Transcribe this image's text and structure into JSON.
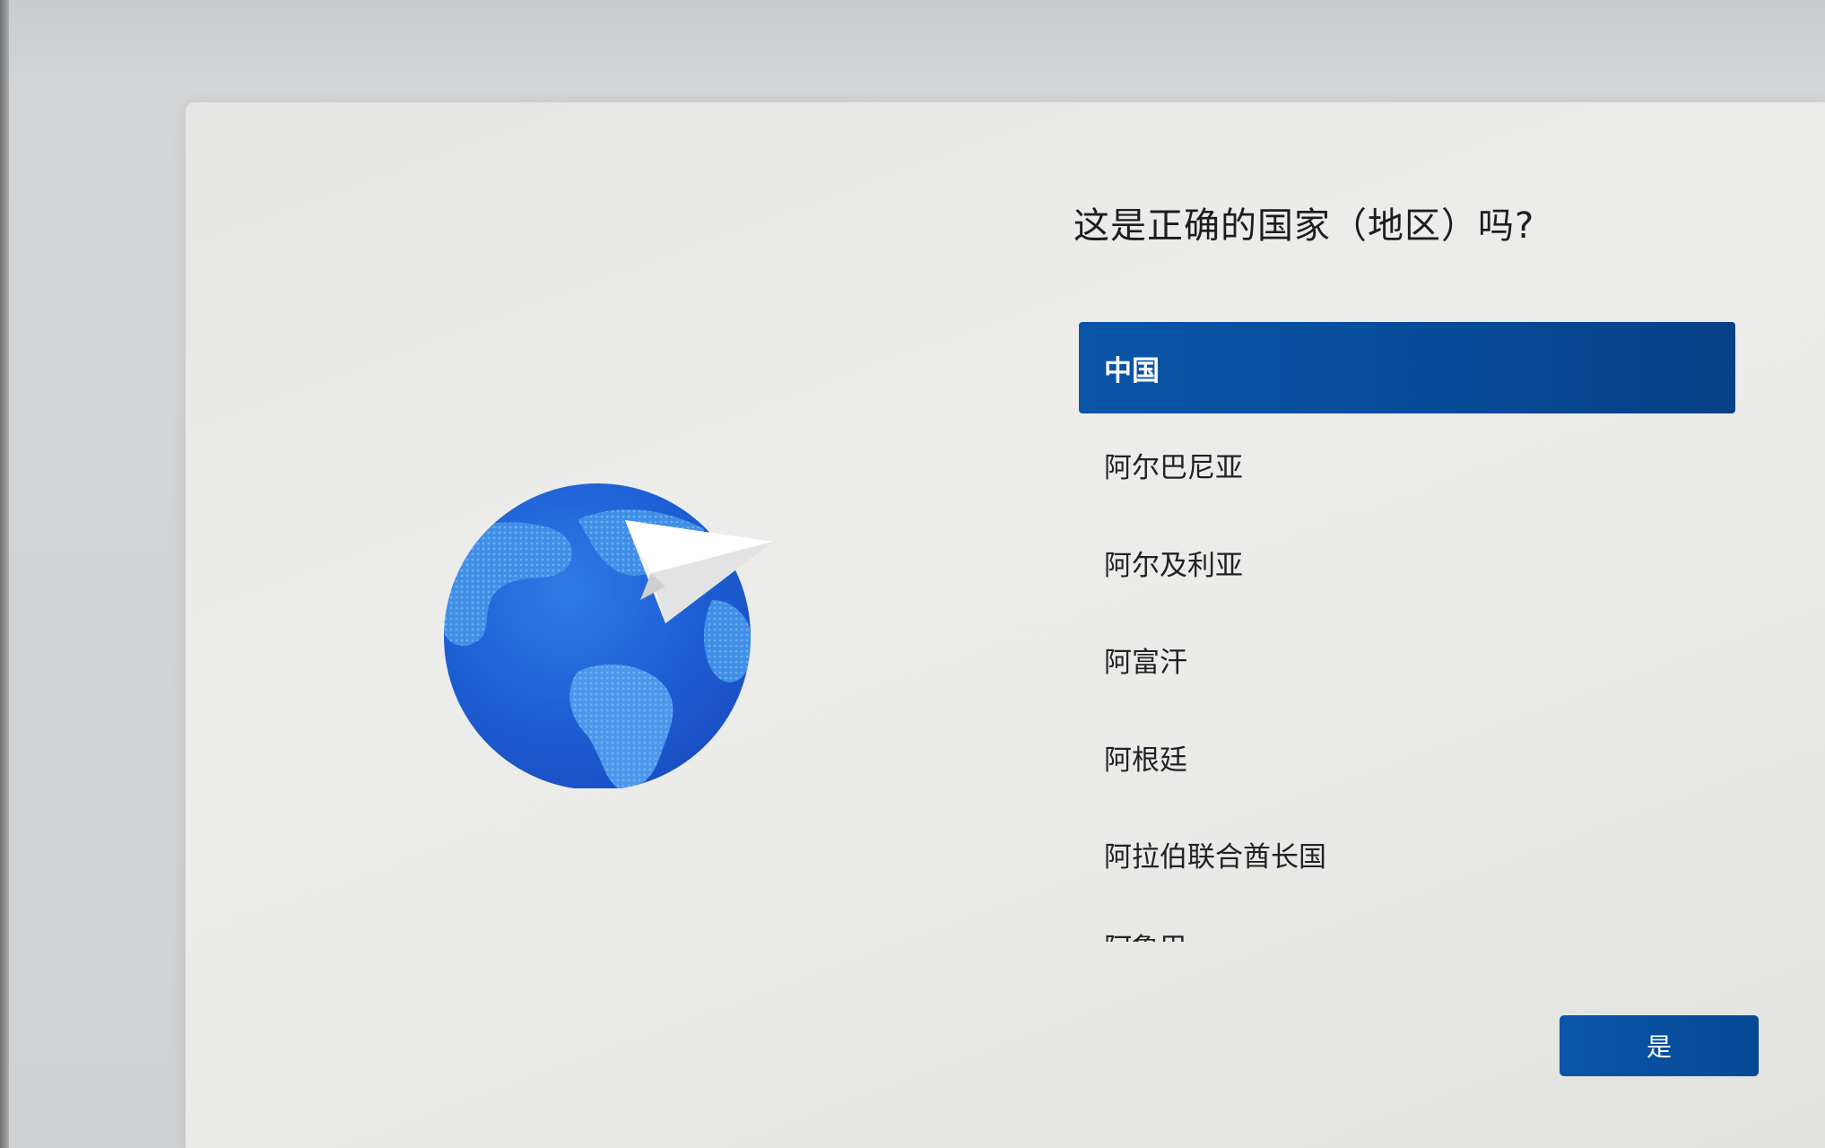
{
  "setup": {
    "question": "这是正确的国家（地区）吗?",
    "countries": [
      {
        "label": "中国",
        "selected": true
      },
      {
        "label": "阿尔巴尼亚",
        "selected": false
      },
      {
        "label": "阿尔及利亚",
        "selected": false
      },
      {
        "label": "阿富汗",
        "selected": false
      },
      {
        "label": "阿根廷",
        "selected": false
      },
      {
        "label": "阿拉伯联合酋长国",
        "selected": false
      },
      {
        "label": "阿鲁巴",
        "selected": false
      }
    ],
    "confirm_label": "是"
  },
  "icons": {
    "hero": "globe-paper-plane-icon"
  },
  "colors": {
    "accent": "#0a52a3",
    "globe_blue": "#1f63d6",
    "text": "#1d1d1d"
  }
}
